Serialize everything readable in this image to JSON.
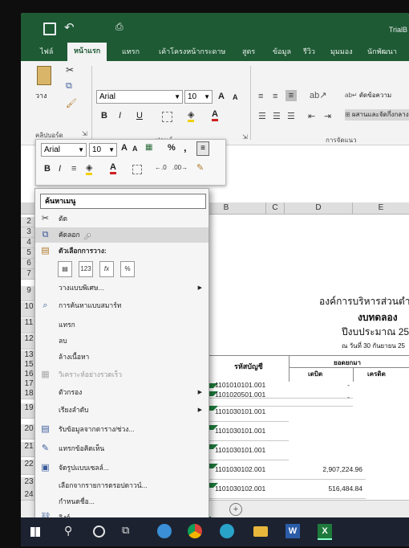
{
  "title_bar": {
    "app_name": "TrialB"
  },
  "ribbon_tabs": [
    "ไฟล์",
    "หน้าแรก",
    "แทรก",
    "เค้าโครงหน้ากระดาษ",
    "สูตร",
    "ข้อมูล",
    "รีวิว",
    "มุมมอง",
    "นักพัฒนา"
  ],
  "ribbon": {
    "paste_label": "วาง",
    "clipboard_group": "คลิปบอร์ด",
    "font_name": "Arial",
    "font_size": "10",
    "font_group": "ฟอนต์",
    "wrap_text": "ตัดข้อความ",
    "merge_center": "ผสานและจัดกึ่งกลาง",
    "alignment_group": "การจัดแนว",
    "bold": "B",
    "italic": "I",
    "underline": "U",
    "grow_font": "A",
    "shrink_font": "A",
    "font_color": "A"
  },
  "mini_toolbar": {
    "font_name": "Arial",
    "font_size": "10",
    "percent": "%",
    "comma": ","
  },
  "grid": {
    "name_box": "A",
    "columns": [
      "B",
      "C",
      "D",
      "E"
    ],
    "rows": [
      "2",
      "3",
      "4",
      "5",
      "6",
      "7",
      "9",
      "10",
      "11",
      "12",
      "13",
      "15",
      "16",
      "17",
      "18",
      "19",
      "20",
      "21",
      "22",
      "23",
      "24"
    ],
    "org_name": "องค์การบริหารส่วนตำบล",
    "report_title": "งบทดลอง",
    "fiscal_year": "ปีงบประมาณ 256",
    "as_of": "ณ วันที่ 30 กันยายน 25",
    "header_account_code": "รหัสบัญชี",
    "header_balance": "ยอดยกมา",
    "header_debit": "เดบิต",
    "header_credit": "เครดิต",
    "accounts": [
      {
        "code": "1101010101.001",
        "debit": "-"
      },
      {
        "code": "1101020501.001",
        "debit": "-"
      },
      {
        "code": "1101030101.001",
        "debit": ""
      },
      {
        "code": "1101030101.001",
        "debit": ""
      },
      {
        "code": "1101030101.001",
        "debit": ""
      },
      {
        "code": "1101030102.001",
        "debit": "2,907,224.96"
      },
      {
        "code": "1101030102.001",
        "debit": "516,484.84"
      }
    ],
    "sheet_tab": "port",
    "add_sheet": "+"
  },
  "context_menu": {
    "search_placeholder": "ค้นหาเมนู",
    "items": [
      {
        "label": "ตัด",
        "icon": "cut-icon",
        "glyph": "✂"
      },
      {
        "label": "คัดลอก",
        "icon": "copy-icon",
        "glyph": "⧉"
      },
      {
        "label": "ตัวเลือกการวาง:",
        "icon": "paste-icon",
        "glyph": "📋"
      },
      {
        "label": "วางแบบพิเศษ...",
        "icon": "",
        "glyph": ""
      },
      {
        "label": "การค้นหาแบบสมาร์ท",
        "icon": "smart-lookup-icon",
        "glyph": "⌕"
      },
      {
        "label": "แทรก",
        "icon": "",
        "glyph": ""
      },
      {
        "label": "ลบ",
        "icon": "",
        "glyph": ""
      },
      {
        "label": "ล้างเนื้อหา",
        "icon": "",
        "glyph": ""
      },
      {
        "label": "วิเคราะห์อย่างรวดเร็ว",
        "icon": "quick-analysis-icon",
        "glyph": "▦"
      },
      {
        "label": "ตัวกรอง",
        "icon": "",
        "glyph": ""
      },
      {
        "label": "เรียงลำดับ",
        "icon": "",
        "glyph": ""
      },
      {
        "label": "รับข้อมูลจากตาราง/ช่วง...",
        "icon": "table-icon",
        "glyph": "▤"
      },
      {
        "label": "แทรกข้อคิดเห็น",
        "icon": "comment-icon",
        "glyph": "🗨"
      },
      {
        "label": "จัดรูปแบบเซลล์...",
        "icon": "format-cells-icon",
        "glyph": "▣"
      },
      {
        "label": "เลือกจากรายการดรอปดาวน์...",
        "icon": "",
        "glyph": ""
      },
      {
        "label": "กำหนดชื่อ...",
        "icon": "",
        "glyph": ""
      },
      {
        "label": "ลิงก์",
        "icon": "link-icon",
        "glyph": "🔗"
      }
    ]
  },
  "colors": {
    "excel_green": "#1e5a34",
    "taskbar": "#1c2230",
    "highlight": "#d8d8d8"
  }
}
